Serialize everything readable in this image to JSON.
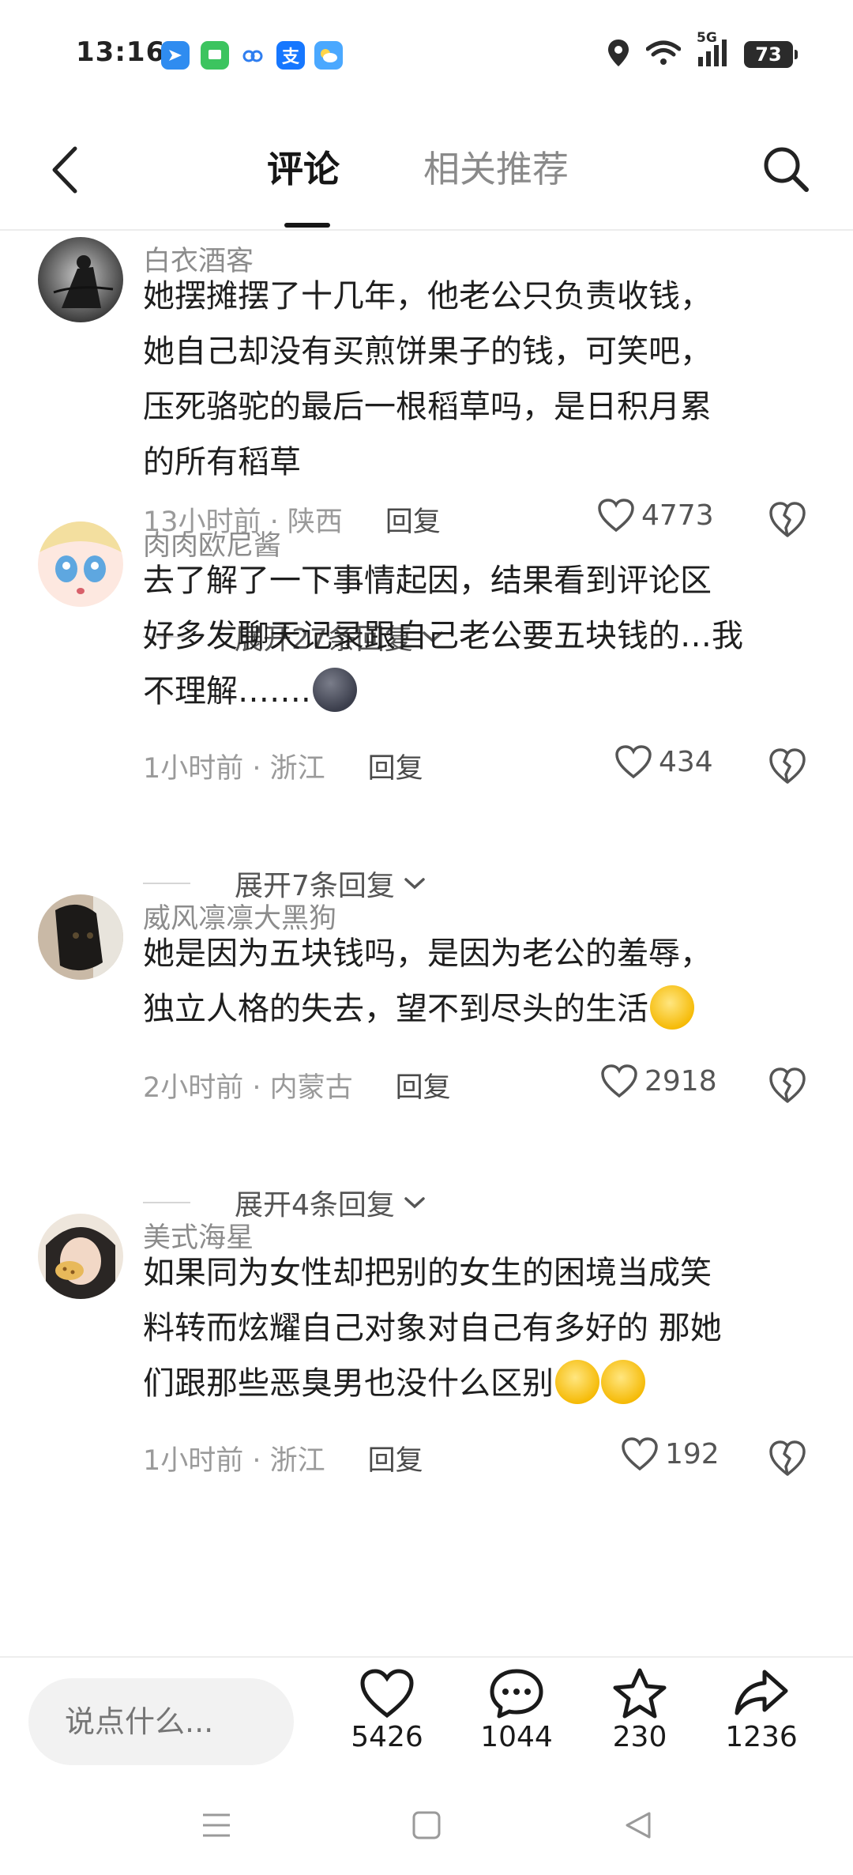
{
  "status_bar": {
    "time": "13:16",
    "network": "5G",
    "battery": "73",
    "app_icons": [
      {
        "name": "plane-app-icon",
        "color": "#2f8cf0"
      },
      {
        "name": "message-app-icon",
        "color": "#3cc45f"
      },
      {
        "name": "cloud-app-icon",
        "color": "#2f7ef0"
      },
      {
        "name": "alipay-app-icon",
        "color": "#1677ff"
      },
      {
        "name": "weather-app-icon",
        "color": "#4aa8ff"
      }
    ]
  },
  "header": {
    "tab_comments": "评论",
    "tab_related": "相关推荐"
  },
  "comments": [
    {
      "username": "白衣酒客",
      "lines": [
        "她摆摊摆了十几年，他老公只负责收钱，",
        "她自己却没有买煎饼果子的钱，可笑吧，",
        "压死骆驼的最后一根稻草吗，是日积月累",
        "的所有稻草"
      ],
      "time_location": "13小时前 · 陕西",
      "reply": "回复",
      "likes": "4773",
      "expand": "展开27条回复"
    },
    {
      "username": "肉肉欧尼酱",
      "lines": [
        "去了解了一下事情起因，结果看到评论区",
        "好多发聊天记录跟自己老公要五块钱的…我",
        "不理解……."
      ],
      "time_location": "1小时前 · 浙江",
      "reply": "回复",
      "likes": "434",
      "expand": "展开7条回复"
    },
    {
      "username": "威风凛凛大黑狗",
      "lines": [
        "她是因为五块钱吗，是因为老公的羞辱，",
        "独立人格的失去，望不到尽头的生活"
      ],
      "time_location": "2小时前 · 内蒙古",
      "reply": "回复",
      "likes": "2918",
      "expand": "展开4条回复"
    },
    {
      "username": "美式海星",
      "lines": [
        "如果同为女性却把别的女生的困境当成笑",
        "料转而炫耀自己对象对自己有多好的 那她",
        "们跟那些恶臭男也没什么区别"
      ],
      "time_location": "1小时前 · 浙江",
      "reply": "回复",
      "likes": "192"
    }
  ],
  "bottom_bar": {
    "input_placeholder": "说点什么...",
    "likes": "5426",
    "comments": "1044",
    "favorites": "230",
    "shares": "1236"
  }
}
